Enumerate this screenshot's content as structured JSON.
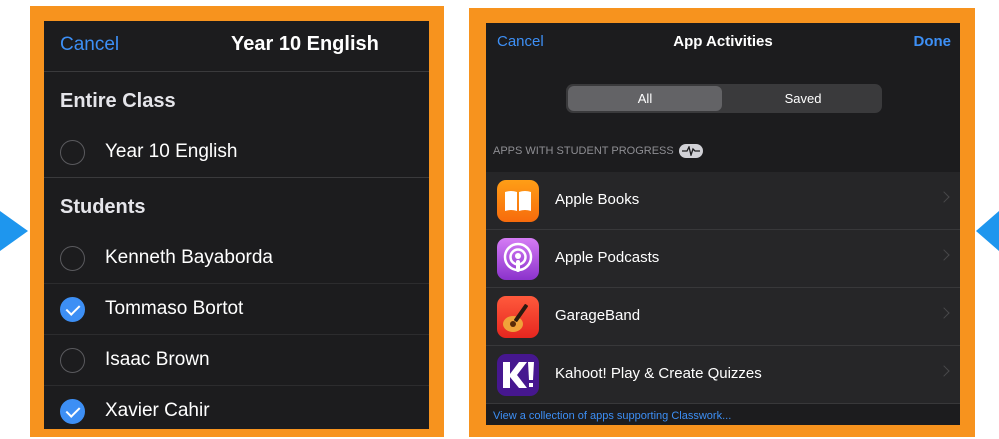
{
  "left": {
    "cancel_label": "Cancel",
    "title": "Year 10 English",
    "sections": [
      {
        "header": "Entire Class",
        "items": [
          {
            "label": "Year 10 English",
            "checked": false
          }
        ]
      },
      {
        "header": "Students",
        "items": [
          {
            "label": "Kenneth Bayaborda",
            "checked": false
          },
          {
            "label": "Tommaso Bortot",
            "checked": true
          },
          {
            "label": "Isaac Brown",
            "checked": false
          },
          {
            "label": "Xavier Cahir",
            "checked": true
          }
        ]
      }
    ]
  },
  "right": {
    "cancel_label": "Cancel",
    "title": "App Activities",
    "done_label": "Done",
    "segments": [
      {
        "label": "All",
        "selected": true
      },
      {
        "label": "Saved",
        "selected": false
      }
    ],
    "section_caption": "APPS WITH STUDENT PROGRESS",
    "apps": [
      {
        "label": "Apple Books",
        "icon": "apple-books-icon"
      },
      {
        "label": "Apple Podcasts",
        "icon": "apple-podcasts-icon"
      },
      {
        "label": "GarageBand",
        "icon": "garageband-icon"
      },
      {
        "label": "Kahoot! Play & Create Quizzes",
        "icon": "kahoot-icon"
      }
    ],
    "footer_link": "View a collection of apps supporting Classwork..."
  },
  "colors": {
    "frame": "#f7931e",
    "arrow": "#1e96ee",
    "accent": "#3d8ff5",
    "background": "#1c1c1e"
  }
}
